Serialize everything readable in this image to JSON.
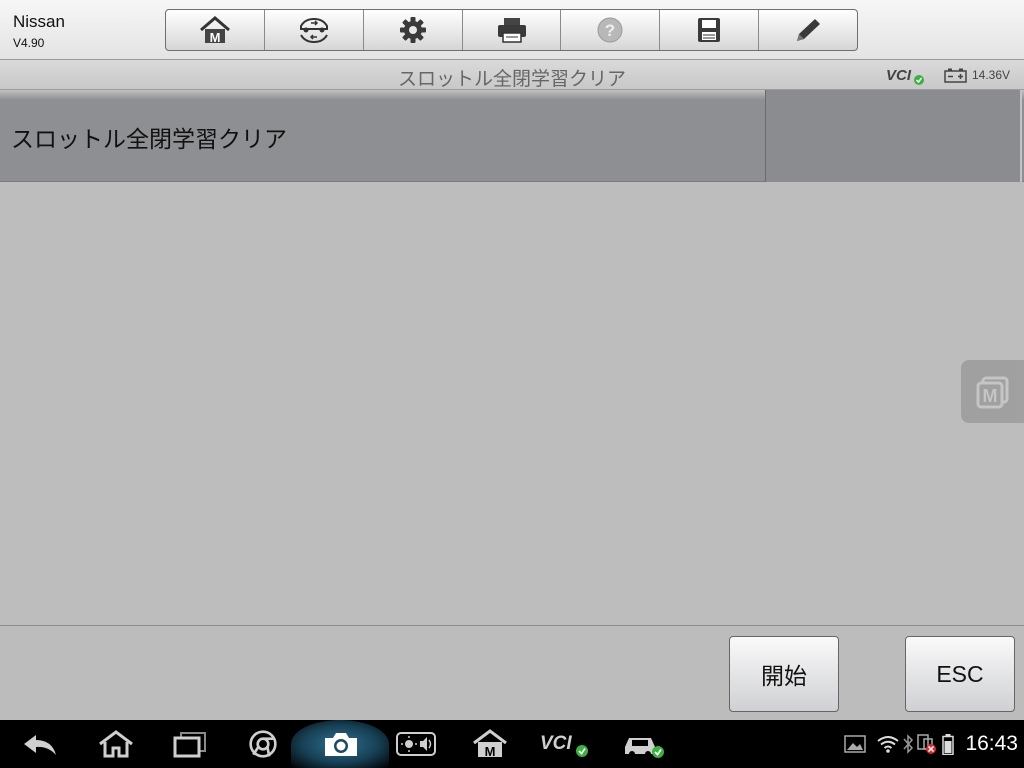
{
  "header": {
    "app_name": "Nissan",
    "version": "V4.90",
    "toolbar": [
      {
        "id": "home",
        "icon": "home-icon"
      },
      {
        "id": "vehicle-swap",
        "icon": "vehicle-swap-icon"
      },
      {
        "id": "settings",
        "icon": "gear-icon"
      },
      {
        "id": "print",
        "icon": "printer-icon"
      },
      {
        "id": "help",
        "icon": "help-icon"
      },
      {
        "id": "save",
        "icon": "save-icon"
      },
      {
        "id": "edit",
        "icon": "pencil-icon"
      }
    ]
  },
  "title_bar": {
    "title": "スロットル全閉学習クリア",
    "vci_label": "VCI",
    "voltage": "14.36V"
  },
  "function_list": {
    "items": [
      {
        "label": "スロットル全閉学習クリア"
      }
    ]
  },
  "actions": {
    "start_label": "開始",
    "esc_label": "ESC"
  },
  "nav_bar": {
    "vci_label": "VCI",
    "time": "16:43"
  },
  "colors": {
    "accent_green": "#3cb043",
    "camera_highlight": "#2f6f8f"
  }
}
